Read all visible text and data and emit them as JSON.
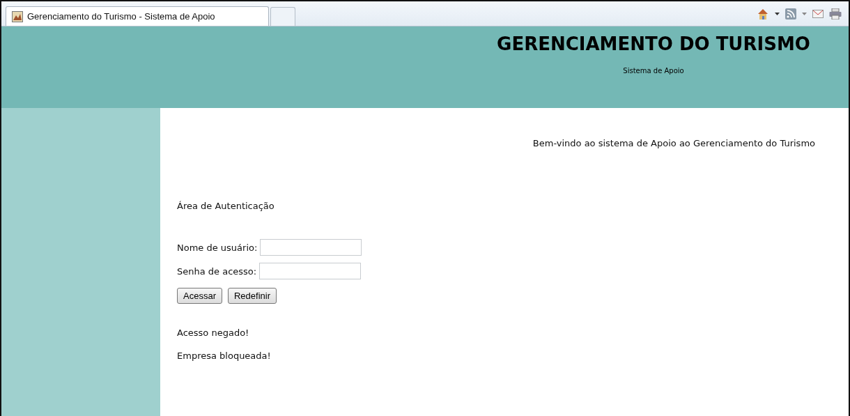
{
  "browser": {
    "tab_title": "Gerenciamento do Turismo - Sistema de Apoio"
  },
  "header": {
    "title": "GERENCIAMENTO DO TURISMO",
    "subtitle": "Sistema de Apoio"
  },
  "welcome": "Bem-vindo ao sistema de Apoio ao Gerenciamento do Turismo",
  "auth_heading": "Área de Autenticação",
  "fields": [
    {
      "label": "Nome de usuário:"
    },
    {
      "label": "Senha de acesso:"
    }
  ],
  "buttons": [
    "Acessar",
    "Redefinir"
  ],
  "messages": [
    "Acesso negado!",
    "Empresa bloqueada!"
  ]
}
